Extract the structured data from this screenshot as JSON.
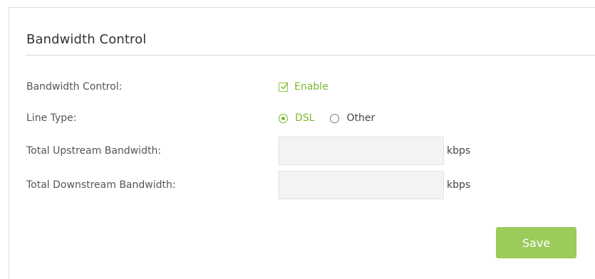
{
  "section": {
    "title": "Bandwidth Control"
  },
  "bandwidth_control": {
    "label": "Bandwidth Control:",
    "checkbox_label": "Enable",
    "checked": true
  },
  "line_type": {
    "label": "Line Type:",
    "options": [
      {
        "label": "DSL",
        "selected": true
      },
      {
        "label": "Other",
        "selected": false
      }
    ]
  },
  "upstream": {
    "label": "Total Upstream Bandwidth:",
    "value": "",
    "unit": "kbps"
  },
  "downstream": {
    "label": "Total Downstream Bandwidth:",
    "value": "",
    "unit": "kbps"
  },
  "actions": {
    "save_label": "Save"
  },
  "colors": {
    "accent": "#7ab730",
    "button": "#9acb5b",
    "input_bg": "#f3f3f3"
  }
}
